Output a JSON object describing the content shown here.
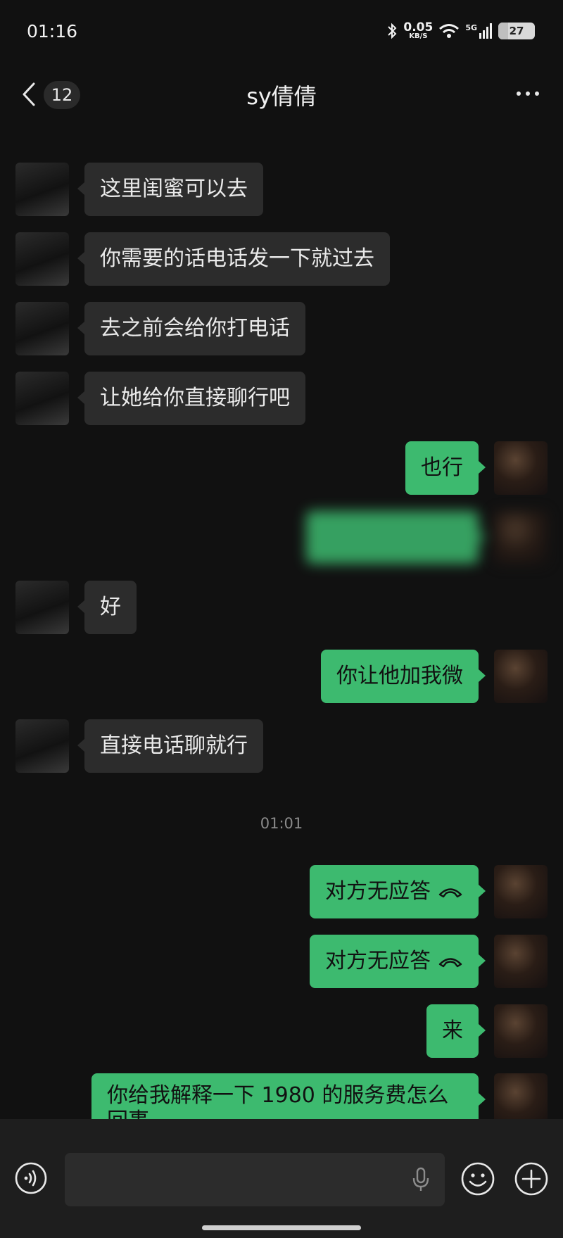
{
  "status": {
    "time": "01:16",
    "speed_value": "0.05",
    "speed_unit": "KB/S",
    "network": "5G",
    "battery": "27"
  },
  "header": {
    "back_count": "12",
    "title": "sy倩倩"
  },
  "messages": [
    {
      "side": "in",
      "text": "这里闺蜜可以去"
    },
    {
      "side": "in",
      "text": "你需要的话电话发一下就过去"
    },
    {
      "side": "in",
      "text": "去之前会给你打电话"
    },
    {
      "side": "in",
      "text": "让她给你直接聊行吧"
    },
    {
      "side": "out",
      "text": "也行"
    },
    {
      "side": "out",
      "text": "",
      "blurred": true
    },
    {
      "side": "in",
      "text": "好"
    },
    {
      "side": "out",
      "text": "你让他加我微"
    },
    {
      "side": "in",
      "text": "直接电话聊就行"
    },
    {
      "side": "out",
      "text": "对方无应答",
      "icon": "hangup-icon"
    },
    {
      "side": "out",
      "text": "对方无应答",
      "icon": "hangup-icon"
    },
    {
      "side": "out",
      "text": "来"
    },
    {
      "side": "out",
      "text": "你给我解释一下 1980 的服务费怎么",
      "text2": "回事"
    }
  ],
  "timestamp": "01:01",
  "bottom": {
    "voice_icon": "voice-mode-icon",
    "mic_icon": "microphone-icon",
    "emoji_icon": "emoji-icon",
    "plus_icon": "plus-icon"
  },
  "colors": {
    "background": "#111111",
    "incoming_bubble": "#2c2c2c",
    "outgoing_bubble": "#3dba6f"
  }
}
